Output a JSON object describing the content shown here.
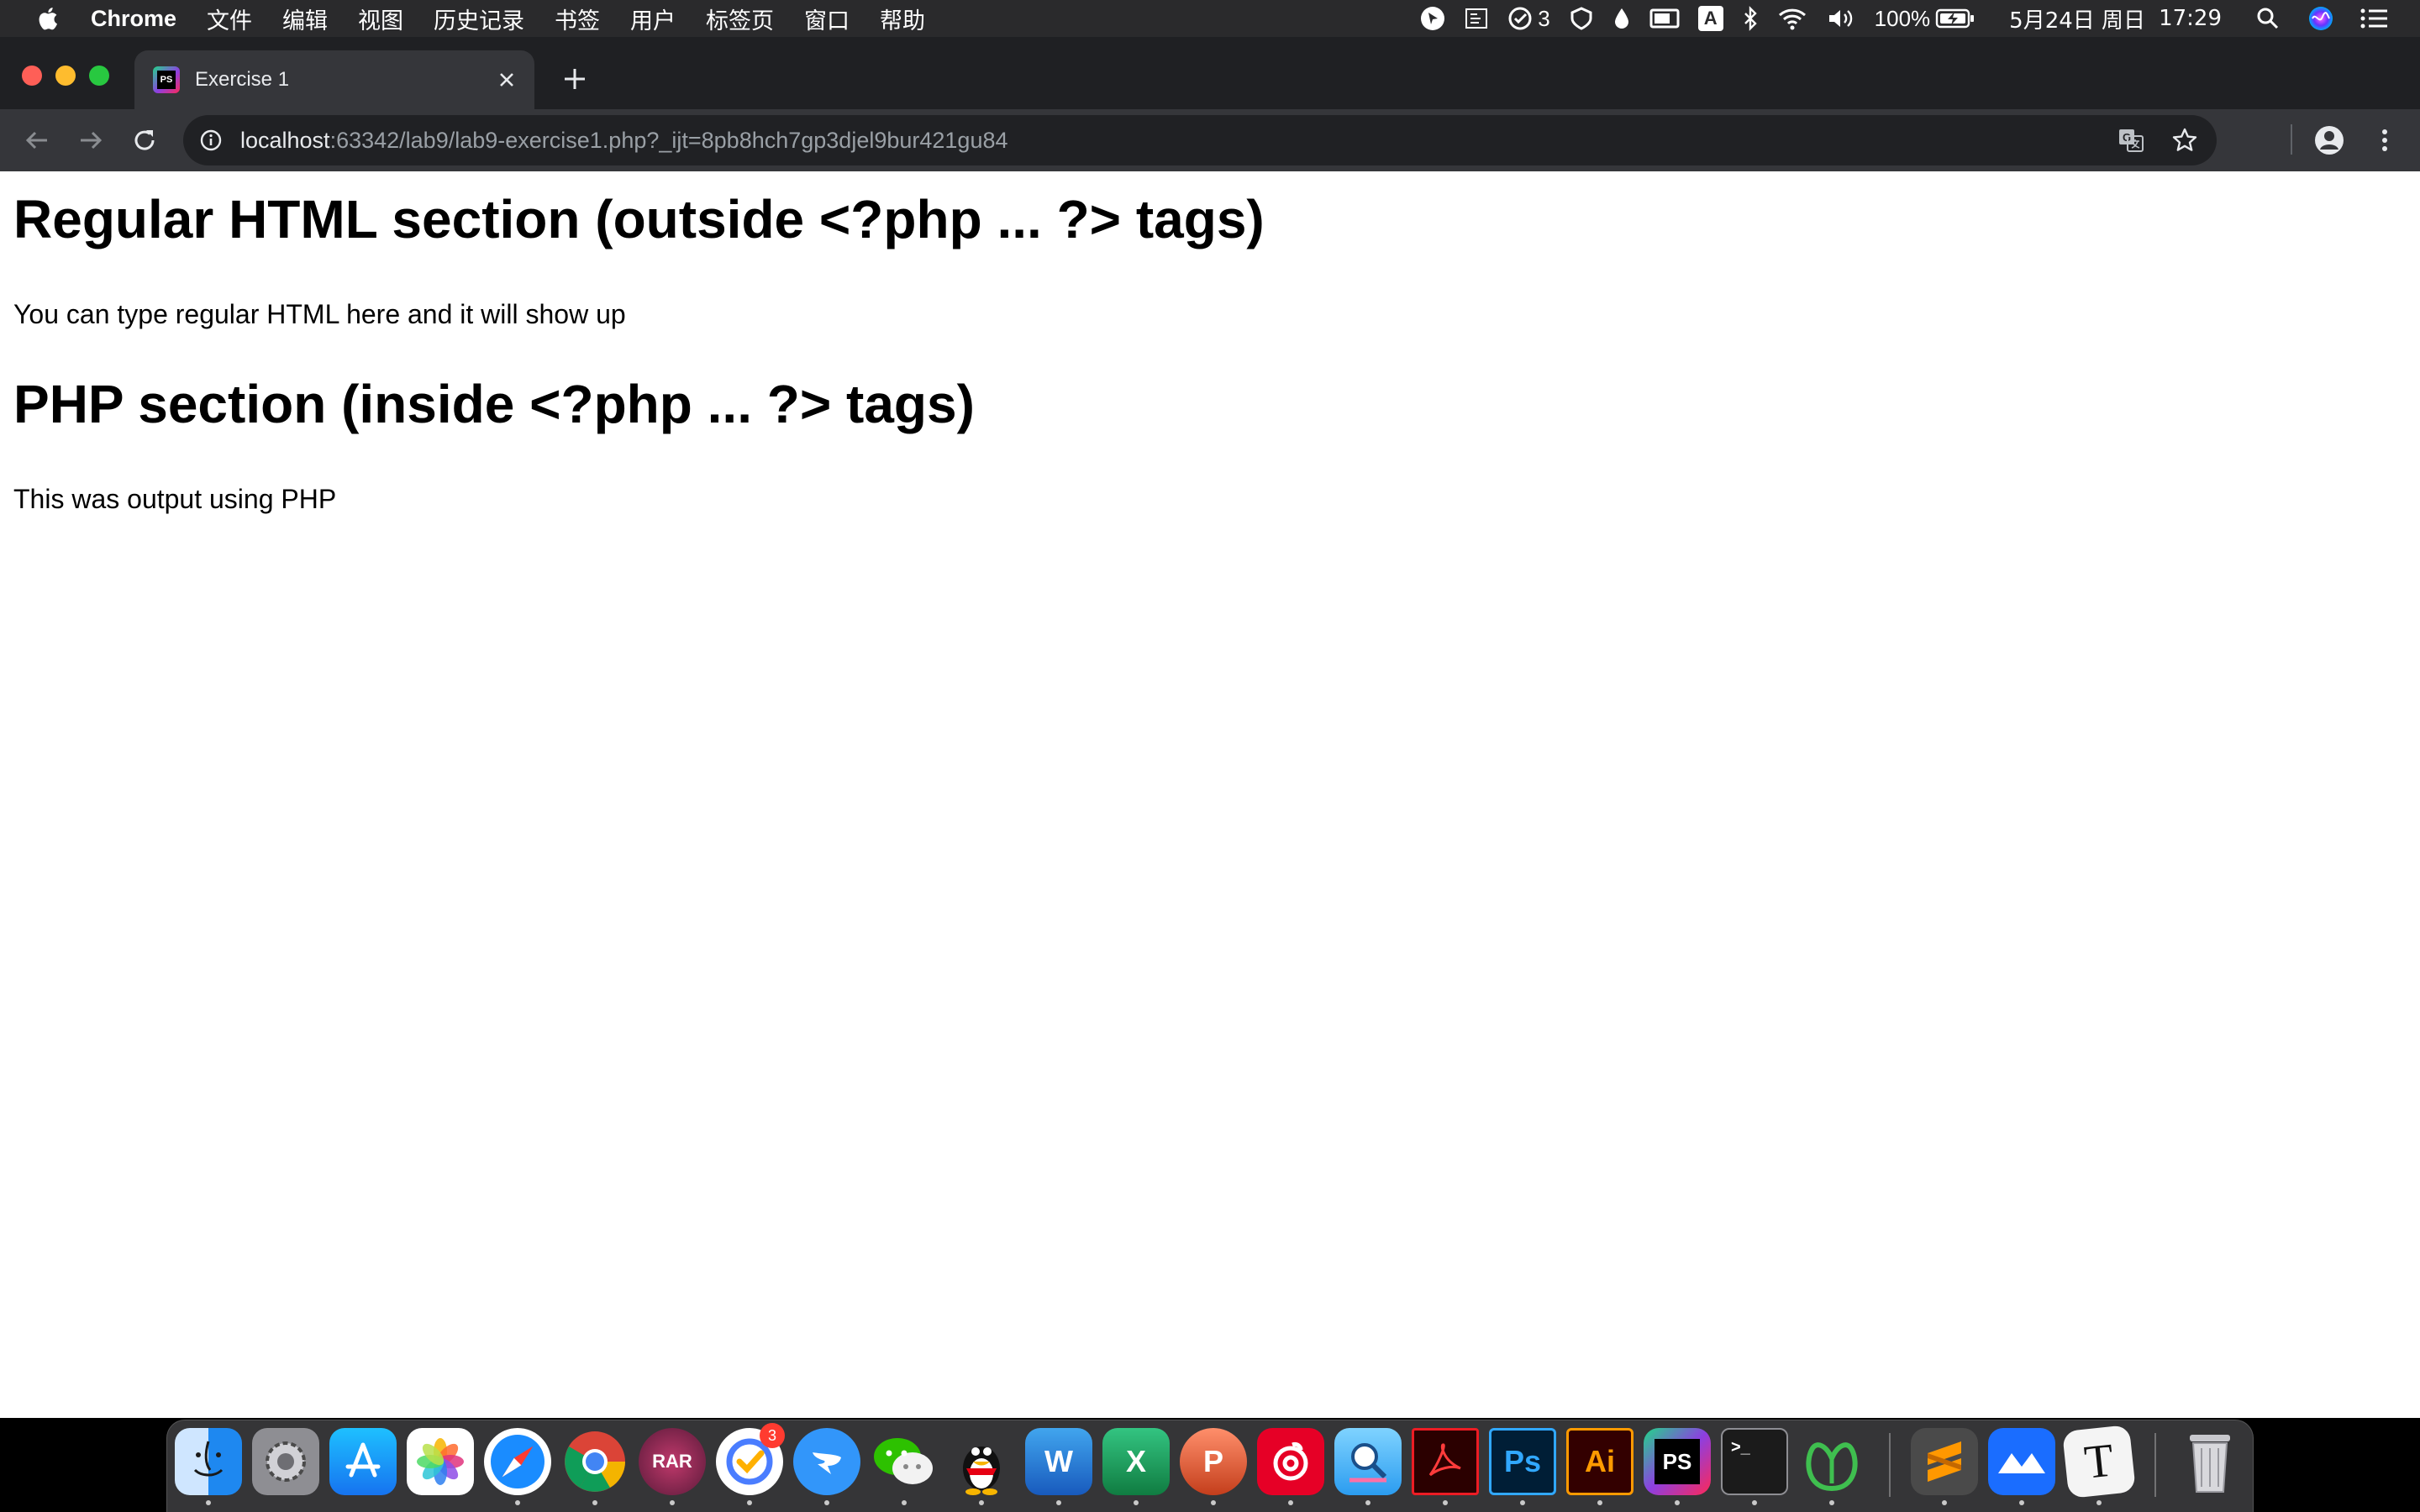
{
  "menubar": {
    "app_name": "Chrome",
    "items": [
      "文件",
      "编辑",
      "视图",
      "历史记录",
      "书签",
      "用户",
      "标签页",
      "窗口",
      "帮助"
    ],
    "status": {
      "ticktick_count": "3",
      "input_method": "A",
      "battery": "100%",
      "date": "5月24日 周日",
      "time": "17:29"
    }
  },
  "browser": {
    "tab": {
      "title": "Exercise 1",
      "favicon": "PS"
    },
    "url": {
      "host": "localhost",
      "rest": ":63342/lab9/lab9-exercise1.php?_ijt=8pb8hch7gp3djel9bur421gu84"
    }
  },
  "page": {
    "heading1": "Regular HTML section (outside <?php ... ?> tags)",
    "paragraph1": "You can type regular HTML here and it will show up",
    "heading2": "PHP section (inside <?php ... ?> tags)",
    "paragraph2": "This was output using PHP"
  },
  "dock": {
    "items": [
      {
        "name": "finder",
        "label": ""
      },
      {
        "name": "system-preferences",
        "label": ""
      },
      {
        "name": "app-store",
        "label": ""
      },
      {
        "name": "photos",
        "label": ""
      },
      {
        "name": "safari",
        "label": ""
      },
      {
        "name": "chrome",
        "label": ""
      },
      {
        "name": "rar-extractor",
        "label": "RAR"
      },
      {
        "name": "ticktick",
        "label": ""
      },
      {
        "name": "dingtalk",
        "label": ""
      },
      {
        "name": "wechat",
        "label": ""
      },
      {
        "name": "qq",
        "label": ""
      },
      {
        "name": "word",
        "label": "W"
      },
      {
        "name": "excel",
        "label": "X"
      },
      {
        "name": "powerpoint",
        "label": "P"
      },
      {
        "name": "netease-music",
        "label": ""
      },
      {
        "name": "preview",
        "label": ""
      },
      {
        "name": "acrobat",
        "label": ""
      },
      {
        "name": "photoshop",
        "label": "Ps"
      },
      {
        "name": "illustrator",
        "label": "Ai"
      },
      {
        "name": "phpstorm",
        "label": "PS"
      },
      {
        "name": "terminal",
        "label": ">_"
      },
      {
        "name": "navicat",
        "label": ""
      },
      {
        "name": "sublime-text",
        "label": ""
      },
      {
        "name": "tencent-meeting",
        "label": ""
      },
      {
        "name": "typora",
        "label": "T"
      },
      {
        "name": "trash",
        "label": ""
      }
    ],
    "ticktick_badge": "3"
  },
  "colors": {
    "menubar_bg": "#2a2a2c",
    "tabstrip_bg": "#1f2023",
    "active_tab_bg": "#35363a",
    "omnibox_bg": "#202124",
    "page_bg": "#ffffff"
  }
}
